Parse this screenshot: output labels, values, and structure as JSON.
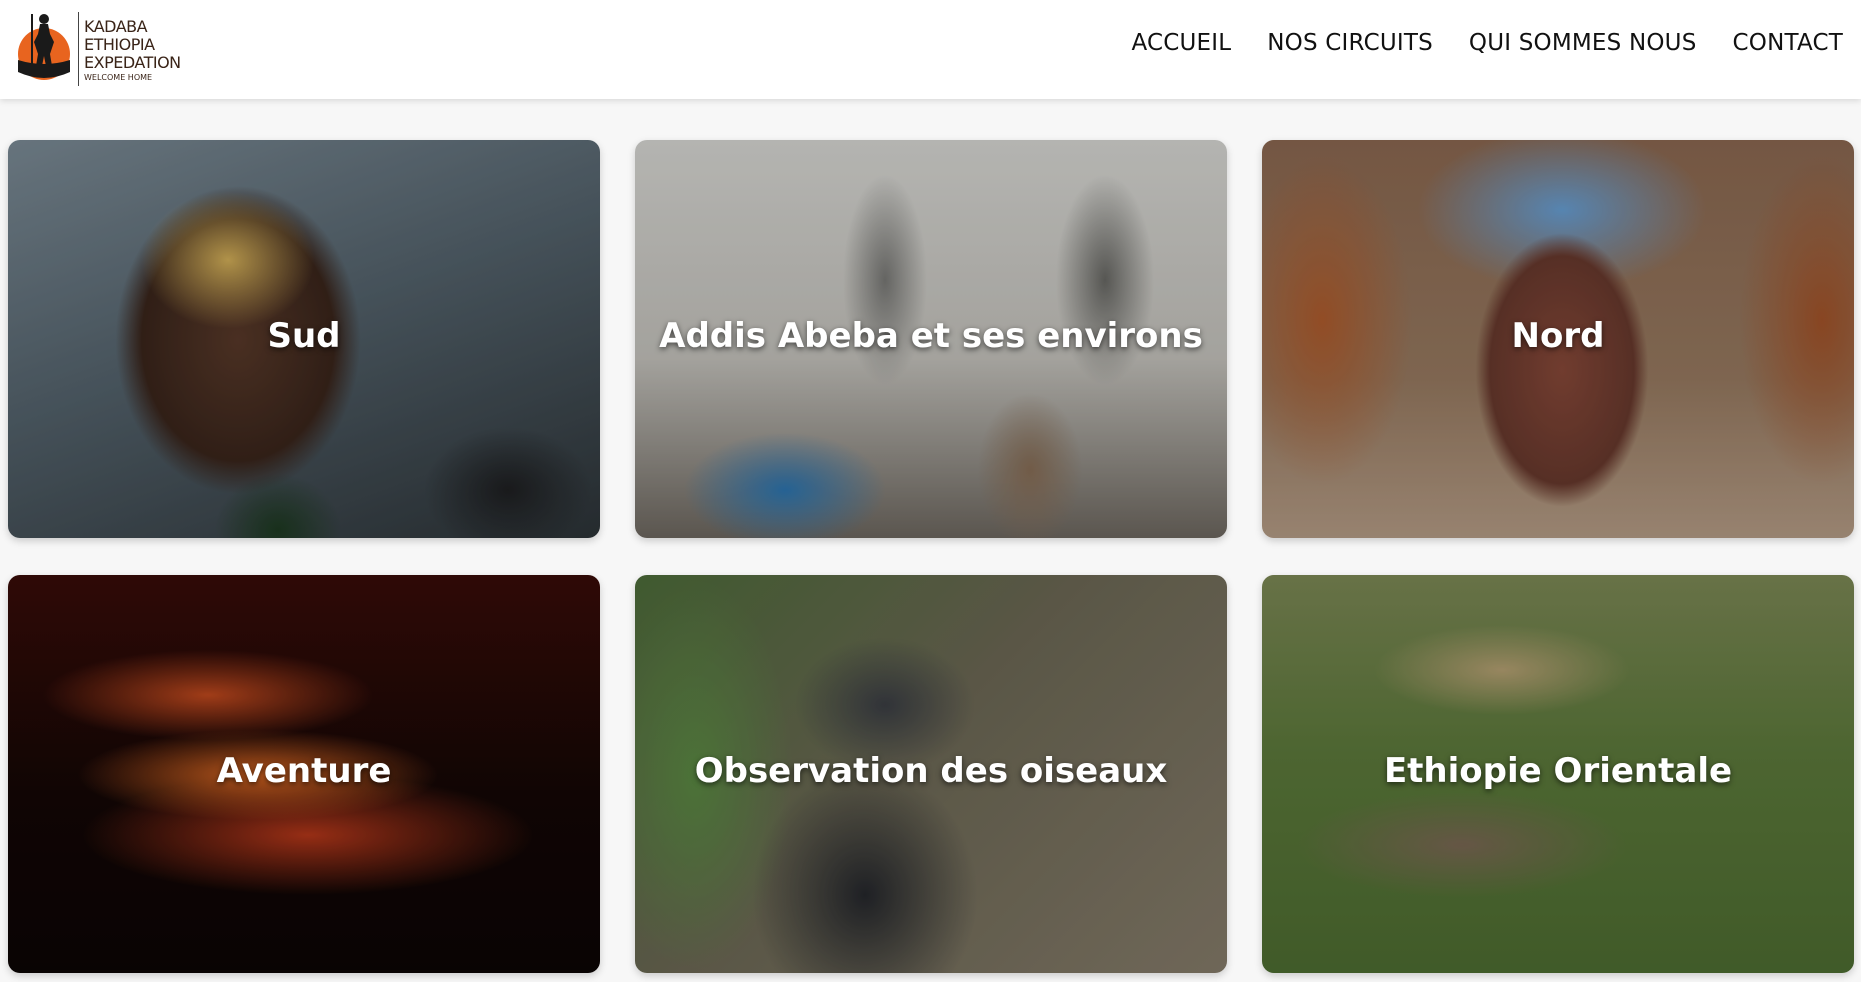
{
  "header": {
    "logo": {
      "lines": [
        "KADABA",
        "ETHIOPIA",
        "EXPEDATION"
      ],
      "tagline": "WELCOME HOME"
    },
    "nav": [
      {
        "label": "ACCUEIL"
      },
      {
        "label": "NOS CIRCUITS"
      },
      {
        "label": "QUI SOMMES NOUS"
      },
      {
        "label": "CONTACT"
      }
    ]
  },
  "cards": [
    {
      "title": "Sud"
    },
    {
      "title": "Addis Abeba et ses environs"
    },
    {
      "title": "Nord"
    },
    {
      "title": "Aventure"
    },
    {
      "title": "Observation des oiseaux"
    },
    {
      "title": "Ethiopie Orientale"
    }
  ]
}
